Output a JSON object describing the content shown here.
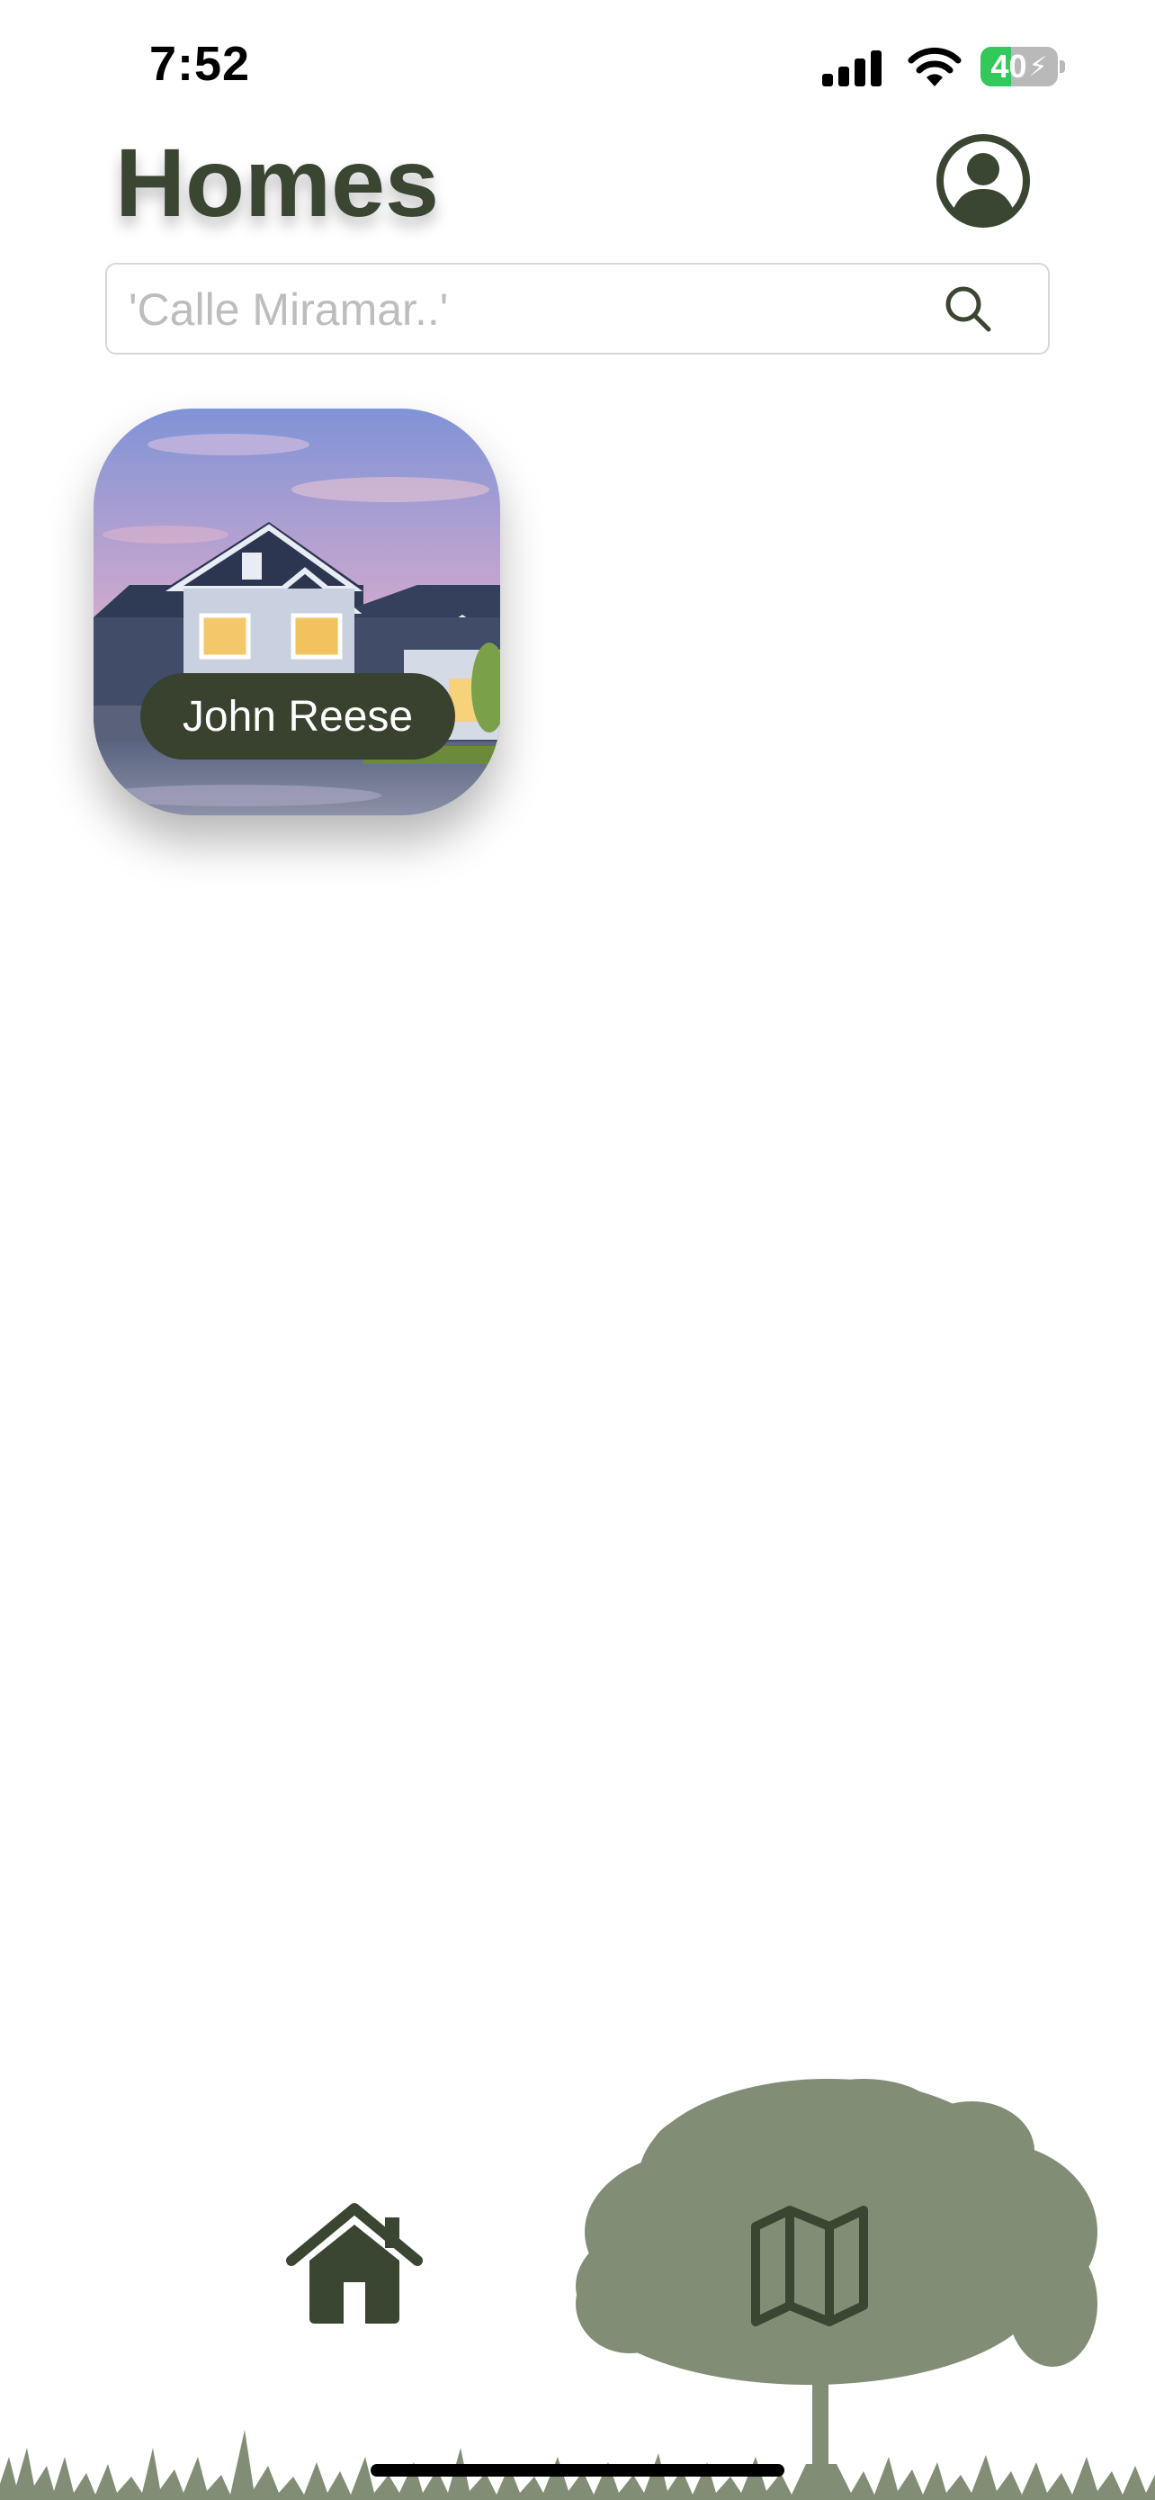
{
  "status_bar": {
    "time": "7:52",
    "battery_percent": 40,
    "battery_label": "40",
    "charging": true
  },
  "header": {
    "title": "Homes",
    "profile_icon": "person-circle-icon"
  },
  "search": {
    "placeholder": "'Calle Miramar..'",
    "value": "",
    "icon": "search-icon"
  },
  "homes": [
    {
      "owner_name": "John Reese"
    }
  ],
  "tab_bar": {
    "items": [
      {
        "name": "home",
        "icon": "house-icon",
        "selected": true
      },
      {
        "name": "map",
        "icon": "map-icon",
        "selected": false
      }
    ]
  },
  "colors": {
    "primary": "#3a4532",
    "label_background": "#38422f",
    "landscape": "#818d75",
    "battery_green": "#34c759"
  }
}
